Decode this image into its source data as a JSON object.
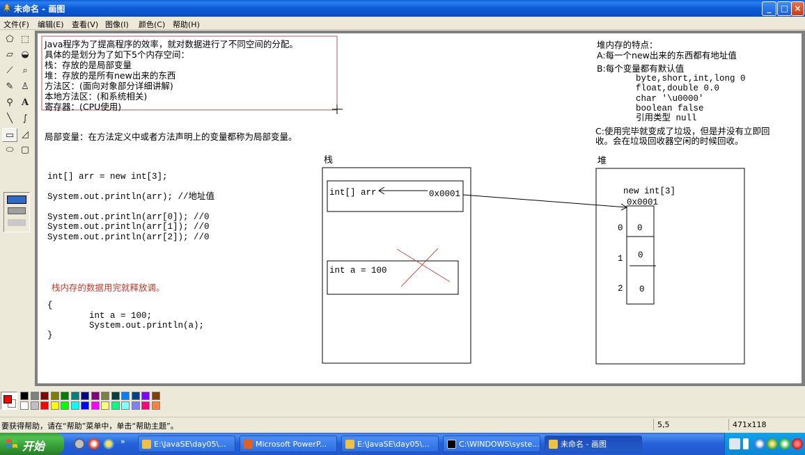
{
  "window": {
    "title": "未命名 - 画图",
    "minimize": "_",
    "maximize": "□",
    "close": "×"
  },
  "menu": [
    "文件(F)",
    "编辑(E)",
    "查看(V)",
    "图像(I)",
    "颜色(C)",
    "帮助(H)"
  ],
  "canvas": {
    "intro_lines": [
      "Java程序为了提高程序的效率，就对数据进行了不同空间的分配。",
      "具体的是划分为了如下5个内存空间：",
      "栈：存放的是局部变量",
      "堆：存放的是所有new出来的东西",
      "方法区：(面向对象部分详细讲解)",
      "本地方法区：(和系统相关)",
      "寄存器：(CPU使用)"
    ],
    "local_var_note": "局部变量：在方法定义中或者方法声明上的变量都称为局部变量。",
    "code_lines": [
      "int[] arr = new int[3];",
      "",
      "System.out.println(arr); //地址值",
      "",
      "System.out.println(arr[0]); //0",
      "System.out.println(arr[1]); //0",
      "System.out.println(arr[2]); //0"
    ],
    "stack_release_note": "栈内存的数据用完就释放调。",
    "block_lines": [
      "{",
      "        int a = 100;",
      "        System.out.println(a);",
      "}"
    ],
    "stack_label": "栈",
    "stack_arr": "int[] arr",
    "stack_arr_value": "0x0001",
    "stack_int": "int a = 100",
    "heap_label": "堆",
    "heap_new": "new int[3]",
    "heap_addr": "0x0001",
    "heap_indices": [
      "0",
      "1",
      "2"
    ],
    "heap_values": [
      "0",
      "0",
      "0"
    ],
    "heap_features_title": "堆内存的特点：",
    "heap_feature_a": "A:每一个new出来的东西都有地址值",
    "heap_feature_b": "B:每个变量都有默认值",
    "heap_defaults": [
      "byte,short,int,long 0",
      "float,double 0.0",
      "char '\\u0000'",
      "boolean false",
      "引用类型 null"
    ],
    "heap_feature_c1": "C:使用完毕就变成了垃圾，但是并没有立即回",
    "heap_feature_c2": "收。会在垃圾回收器空闲的时候回收。"
  },
  "status": {
    "help": "要获得帮助，请在“帮助”菜单中，单击“帮助主题”。",
    "position": "5,5",
    "size": "471x118"
  },
  "taskbar": {
    "start": "开始",
    "buttons": [
      "E:\\JavaSE\\day05\\...",
      "Microsoft PowerP...",
      "E:\\JavaSE\\day05\\...",
      "C:\\WINDOWS\\syste...",
      "未命名 - 画图"
    ]
  },
  "palette_colors": [
    "#000000",
    "#808080",
    "#800000",
    "#808000",
    "#008000",
    "#008080",
    "#000080",
    "#800080",
    "#808040",
    "#004040",
    "#0080ff",
    "#004080",
    "#8000ff",
    "#804000",
    "#ffffff",
    "#c0c0c0",
    "#ff0000",
    "#ffff00",
    "#00ff00",
    "#00ffff",
    "#0000ff",
    "#ff00ff",
    "#ffff80",
    "#00ff80",
    "#80ffff",
    "#8080ff",
    "#ff0080",
    "#ff8040"
  ],
  "colors": {
    "foreground": "#ff0000",
    "background": "#ffffff",
    "annotation_red": "#c0392b"
  }
}
